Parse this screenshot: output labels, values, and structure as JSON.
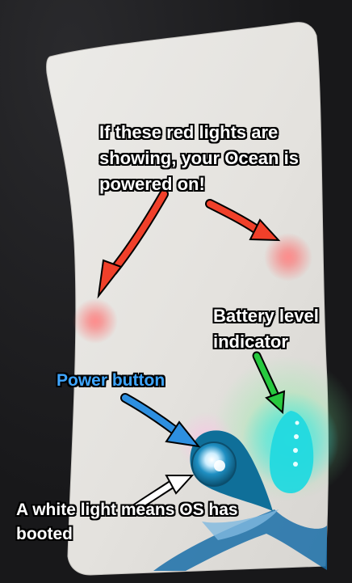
{
  "annotations": {
    "red_lights": "If these red lights are showing, your Ocean is powered on!",
    "battery": "Battery level indicator",
    "power_button": "Power button",
    "white_light": "A white light means OS has booted"
  },
  "colors": {
    "red_arrow": "#f0402a",
    "blue_arrow": "#2d8fe0",
    "green_arrow": "#27c93f",
    "white_arrow": "#ffffff",
    "red_light_glow": "#ff6a6a",
    "battery_glow": "#36e6ea",
    "power_drop": "#0f6f99",
    "power_button_text": "#3fa6ff"
  },
  "icons": {
    "device": "device-panel",
    "power": "power-button-icon",
    "battery": "battery-level-icon",
    "red_light": "red-light-icon"
  }
}
